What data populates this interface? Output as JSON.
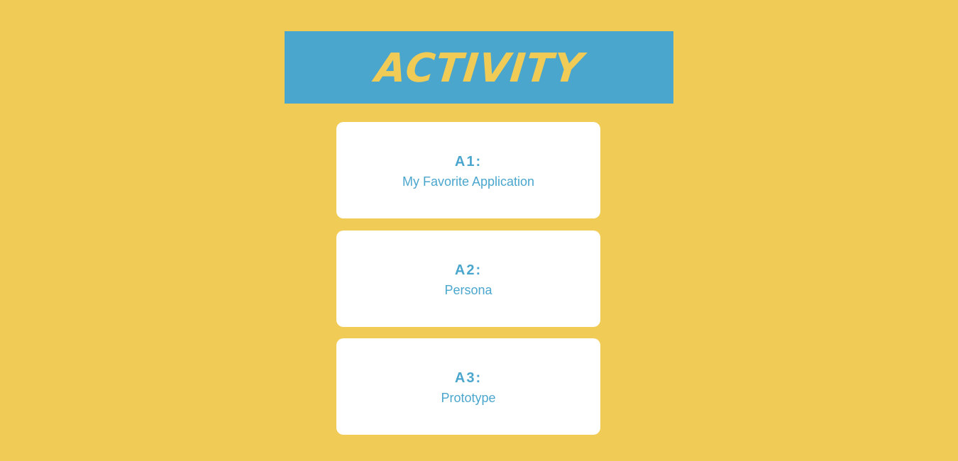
{
  "header": {
    "title": "ACTIVITY"
  },
  "activities": [
    {
      "code": "A1:",
      "title": "My Favorite Application"
    },
    {
      "code": "A2:",
      "title": "Persona"
    },
    {
      "code": "A3:",
      "title": "Prototype"
    }
  ],
  "colors": {
    "background": "#F0CB55",
    "accent": "#4BA6CE",
    "card": "#FFFFFF"
  }
}
